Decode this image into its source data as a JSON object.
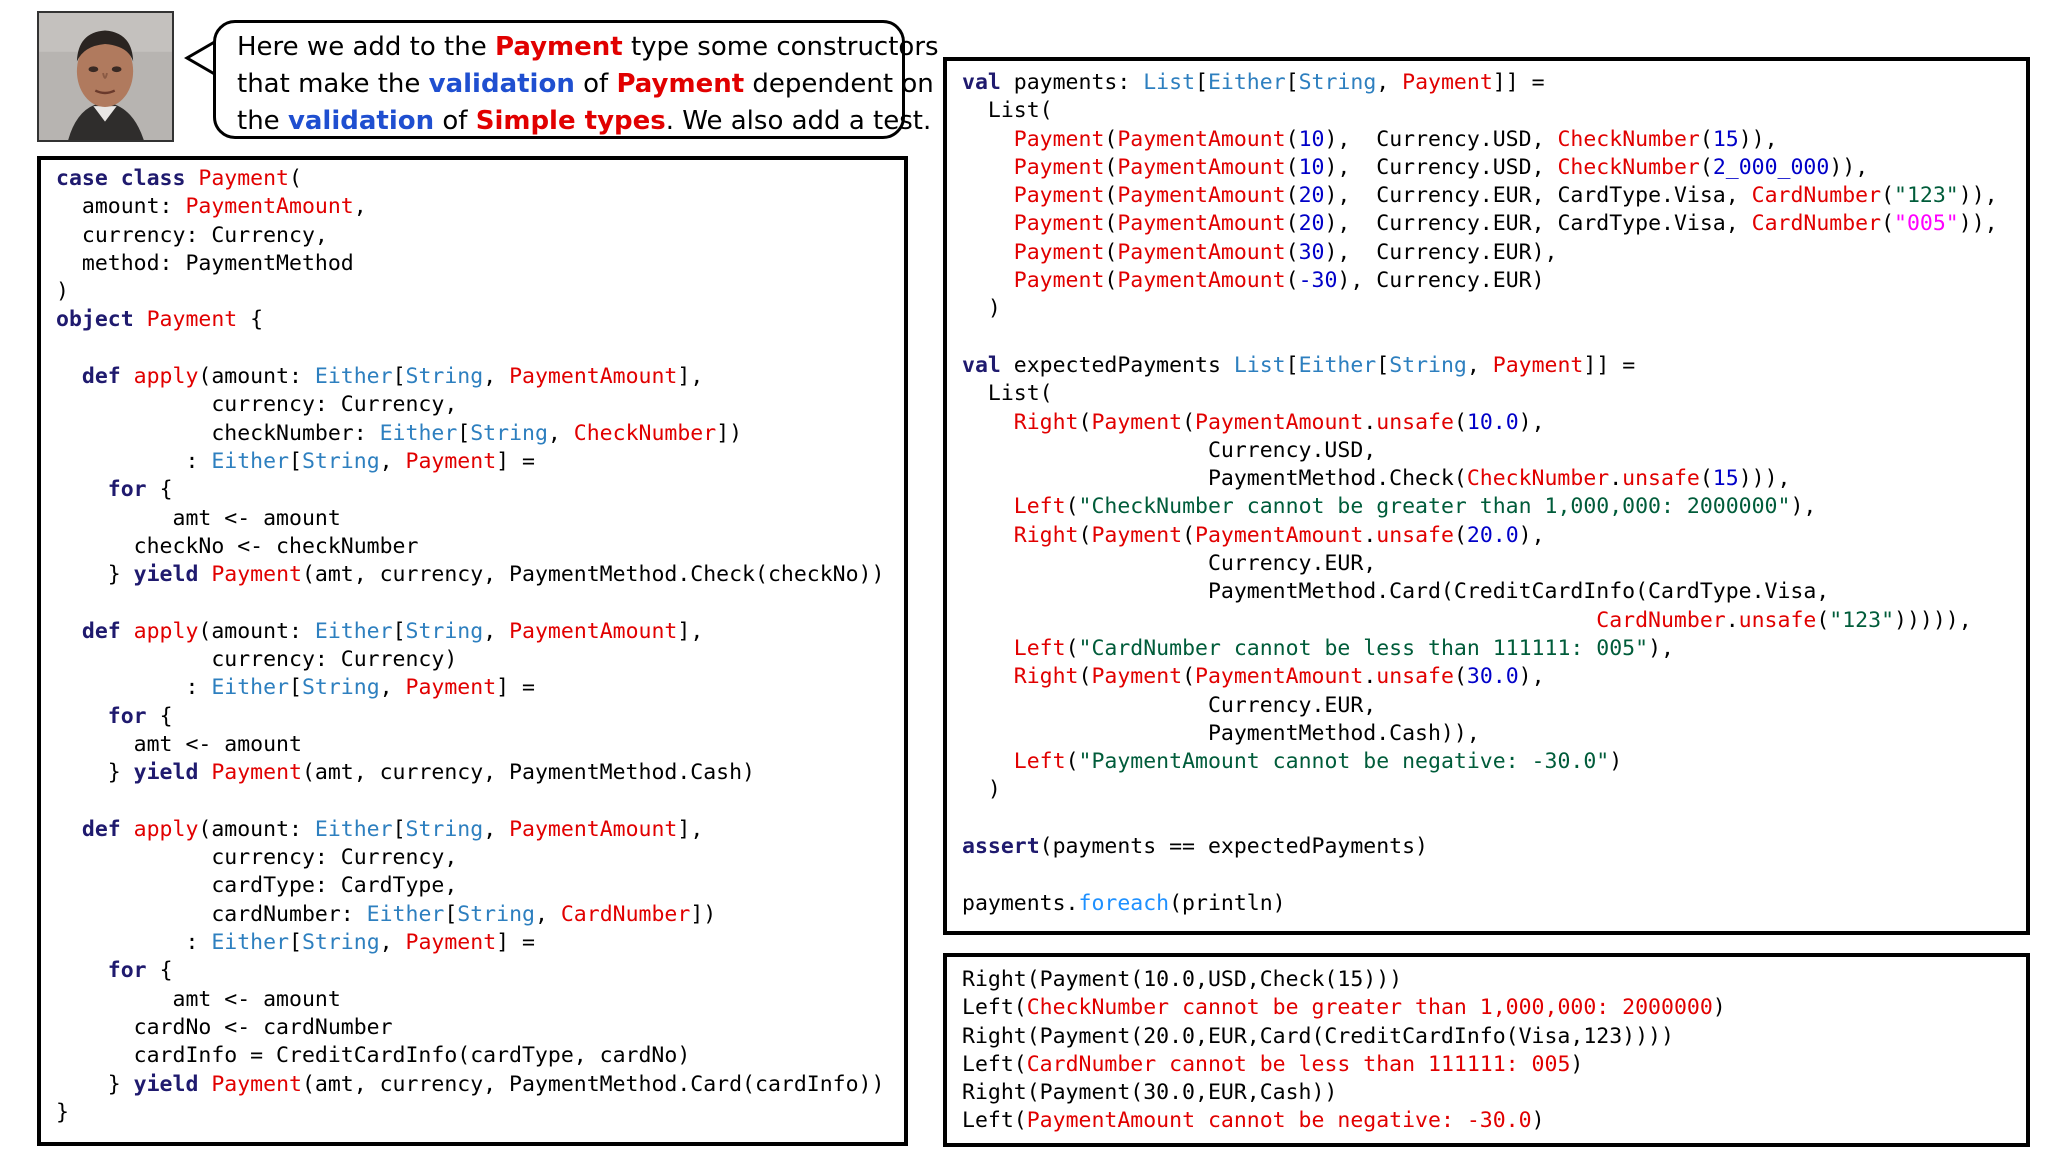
{
  "bubble": {
    "line1": [
      {
        "text": "Here we add to the ",
        "style": ""
      },
      {
        "text": "Payment",
        "style": "hi-red"
      },
      {
        "text": " type some constructors",
        "style": ""
      }
    ],
    "line2": [
      {
        "text": "that make the ",
        "style": ""
      },
      {
        "text": "validation",
        "style": "hi-blue"
      },
      {
        "text": " of ",
        "style": ""
      },
      {
        "text": "Payment",
        "style": "hi-red"
      },
      {
        "text": " dependent on",
        "style": ""
      }
    ],
    "line3": [
      {
        "text": "the ",
        "style": ""
      },
      {
        "text": "validation",
        "style": "hi-blue"
      },
      {
        "text": " of ",
        "style": ""
      },
      {
        "text": "Simple types",
        "style": "hi-red"
      },
      {
        "text": ". We also add a test.",
        "style": ""
      }
    ]
  },
  "left_code": [
    [
      [
        "kw",
        "case class "
      ],
      [
        "t",
        "Payment"
      ],
      [
        "p",
        "("
      ]
    ],
    [
      [
        "p",
        "  amount: "
      ],
      [
        "t",
        "PaymentAmount"
      ],
      [
        "p",
        ","
      ]
    ],
    [
      [
        "p",
        "  currency: Currency,"
      ]
    ],
    [
      [
        "p",
        "  method: PaymentMethod"
      ]
    ],
    [
      [
        "p",
        ")"
      ]
    ],
    [
      [
        "kw",
        "object "
      ],
      [
        "t",
        "Payment"
      ],
      [
        "p",
        " {"
      ]
    ],
    [
      [
        "p",
        ""
      ]
    ],
    [
      [
        "p",
        "  "
      ],
      [
        "kw",
        "def "
      ],
      [
        "t",
        "apply"
      ],
      [
        "p",
        "(amount: "
      ],
      [
        "n",
        "Either"
      ],
      [
        "p",
        "["
      ],
      [
        "n",
        "String"
      ],
      [
        "p",
        ", "
      ],
      [
        "t",
        "PaymentAmount"
      ],
      [
        "p",
        "],"
      ]
    ],
    [
      [
        "p",
        "            currency: Currency,"
      ]
    ],
    [
      [
        "p",
        "            checkNumber: "
      ],
      [
        "n",
        "Either"
      ],
      [
        "p",
        "["
      ],
      [
        "n",
        "String"
      ],
      [
        "p",
        ", "
      ],
      [
        "t",
        "CheckNumber"
      ],
      [
        "p",
        "])"
      ]
    ],
    [
      [
        "p",
        "          : "
      ],
      [
        "n",
        "Either"
      ],
      [
        "p",
        "["
      ],
      [
        "n",
        "String"
      ],
      [
        "p",
        ", "
      ],
      [
        "t",
        "Payment"
      ],
      [
        "p",
        "] ="
      ]
    ],
    [
      [
        "p",
        "    "
      ],
      [
        "kw",
        "for"
      ],
      [
        "p",
        " {"
      ]
    ],
    [
      [
        "p",
        "         amt <- amount"
      ]
    ],
    [
      [
        "p",
        "      checkNo <- checkNumber"
      ]
    ],
    [
      [
        "p",
        "    } "
      ],
      [
        "kw",
        "yield "
      ],
      [
        "t",
        "Payment"
      ],
      [
        "p",
        "(amt, currency, PaymentMethod.Check(checkNo))"
      ]
    ],
    [
      [
        "p",
        ""
      ]
    ],
    [
      [
        "p",
        "  "
      ],
      [
        "kw",
        "def "
      ],
      [
        "t",
        "apply"
      ],
      [
        "p",
        "(amount: "
      ],
      [
        "n",
        "Either"
      ],
      [
        "p",
        "["
      ],
      [
        "n",
        "String"
      ],
      [
        "p",
        ", "
      ],
      [
        "t",
        "PaymentAmount"
      ],
      [
        "p",
        "],"
      ]
    ],
    [
      [
        "p",
        "            currency: Currency)"
      ]
    ],
    [
      [
        "p",
        "          : "
      ],
      [
        "n",
        "Either"
      ],
      [
        "p",
        "["
      ],
      [
        "n",
        "String"
      ],
      [
        "p",
        ", "
      ],
      [
        "t",
        "Payment"
      ],
      [
        "p",
        "] ="
      ]
    ],
    [
      [
        "p",
        "    "
      ],
      [
        "kw",
        "for"
      ],
      [
        "p",
        " {"
      ]
    ],
    [
      [
        "p",
        "      amt <- amount"
      ]
    ],
    [
      [
        "p",
        "    } "
      ],
      [
        "kw",
        "yield "
      ],
      [
        "t",
        "Payment"
      ],
      [
        "p",
        "(amt, currency, PaymentMethod.Cash)"
      ]
    ],
    [
      [
        "p",
        ""
      ]
    ],
    [
      [
        "p",
        "  "
      ],
      [
        "kw",
        "def "
      ],
      [
        "t",
        "apply"
      ],
      [
        "p",
        "(amount: "
      ],
      [
        "n",
        "Either"
      ],
      [
        "p",
        "["
      ],
      [
        "n",
        "String"
      ],
      [
        "p",
        ", "
      ],
      [
        "t",
        "PaymentAmount"
      ],
      [
        "p",
        "],"
      ]
    ],
    [
      [
        "p",
        "            currency: Currency,"
      ]
    ],
    [
      [
        "p",
        "            cardType: CardType,"
      ]
    ],
    [
      [
        "p",
        "            cardNumber: "
      ],
      [
        "n",
        "Either"
      ],
      [
        "p",
        "["
      ],
      [
        "n",
        "String"
      ],
      [
        "p",
        ", "
      ],
      [
        "t",
        "CardNumber"
      ],
      [
        "p",
        "])"
      ]
    ],
    [
      [
        "p",
        "          : "
      ],
      [
        "n",
        "Either"
      ],
      [
        "p",
        "["
      ],
      [
        "n",
        "String"
      ],
      [
        "p",
        ", "
      ],
      [
        "t",
        "Payment"
      ],
      [
        "p",
        "] ="
      ]
    ],
    [
      [
        "p",
        "    "
      ],
      [
        "kw",
        "for"
      ],
      [
        "p",
        " {"
      ]
    ],
    [
      [
        "p",
        "         amt <- amount"
      ]
    ],
    [
      [
        "p",
        "      cardNo <- cardNumber"
      ]
    ],
    [
      [
        "p",
        "      cardInfo = CreditCardInfo(cardType, cardNo)"
      ]
    ],
    [
      [
        "p",
        "    } "
      ],
      [
        "kw",
        "yield "
      ],
      [
        "t",
        "Payment"
      ],
      [
        "p",
        "(amt, currency, PaymentMethod.Card(cardInfo))"
      ]
    ],
    [
      [
        "p",
        "}"
      ]
    ]
  ],
  "right_code": [
    [
      [
        "kw",
        "val "
      ],
      [
        "p",
        "payments: "
      ],
      [
        "n",
        "List"
      ],
      [
        "p",
        "["
      ],
      [
        "n",
        "Either"
      ],
      [
        "p",
        "["
      ],
      [
        "n",
        "String"
      ],
      [
        "p",
        ", "
      ],
      [
        "t",
        "Payment"
      ],
      [
        "p",
        "]] ="
      ]
    ],
    [
      [
        "p",
        "  List("
      ]
    ],
    [
      [
        "p",
        "    "
      ],
      [
        "t",
        "Payment"
      ],
      [
        "p",
        "("
      ],
      [
        "t",
        "PaymentAmount"
      ],
      [
        "p",
        "("
      ],
      [
        "num",
        "10"
      ],
      [
        "p",
        "),  Currency.USD, "
      ],
      [
        "t",
        "CheckNumber"
      ],
      [
        "p",
        "("
      ],
      [
        "num",
        "15"
      ],
      [
        "p",
        ")),"
      ]
    ],
    [
      [
        "p",
        "    "
      ],
      [
        "t",
        "Payment"
      ],
      [
        "p",
        "("
      ],
      [
        "t",
        "PaymentAmount"
      ],
      [
        "p",
        "("
      ],
      [
        "num",
        "10"
      ],
      [
        "p",
        "),  Currency.USD, "
      ],
      [
        "t",
        "CheckNumber"
      ],
      [
        "p",
        "("
      ],
      [
        "num",
        "2_000_000"
      ],
      [
        "p",
        ")),"
      ]
    ],
    [
      [
        "p",
        "    "
      ],
      [
        "t",
        "Payment"
      ],
      [
        "p",
        "("
      ],
      [
        "t",
        "PaymentAmount"
      ],
      [
        "p",
        "("
      ],
      [
        "num",
        "20"
      ],
      [
        "p",
        "),  Currency.EUR, CardType.Visa, "
      ],
      [
        "t",
        "CardNumber"
      ],
      [
        "p",
        "("
      ],
      [
        "s",
        "\"123\""
      ],
      [
        "p",
        ")),"
      ]
    ],
    [
      [
        "p",
        "    "
      ],
      [
        "t",
        "Payment"
      ],
      [
        "p",
        "("
      ],
      [
        "t",
        "PaymentAmount"
      ],
      [
        "p",
        "("
      ],
      [
        "num",
        "20"
      ],
      [
        "p",
        "),  Currency.EUR, CardType.Visa, "
      ],
      [
        "t",
        "CardNumber"
      ],
      [
        "p",
        "("
      ],
      [
        "num5",
        "\"005\""
      ],
      [
        "p",
        ")),"
      ]
    ],
    [
      [
        "p",
        "    "
      ],
      [
        "t",
        "Payment"
      ],
      [
        "p",
        "("
      ],
      [
        "t",
        "PaymentAmount"
      ],
      [
        "p",
        "("
      ],
      [
        "num",
        "30"
      ],
      [
        "p",
        "),  Currency.EUR),"
      ]
    ],
    [
      [
        "p",
        "    "
      ],
      [
        "t",
        "Payment"
      ],
      [
        "p",
        "("
      ],
      [
        "t",
        "PaymentAmount"
      ],
      [
        "p",
        "("
      ],
      [
        "num",
        "-30"
      ],
      [
        "p",
        "), Currency.EUR)"
      ]
    ],
    [
      [
        "p",
        "  )"
      ]
    ],
    [
      [
        "p",
        ""
      ]
    ],
    [
      [
        "kw",
        "val "
      ],
      [
        "p",
        "expectedPayments "
      ],
      [
        "n",
        "List"
      ],
      [
        "p",
        "["
      ],
      [
        "n",
        "Either"
      ],
      [
        "p",
        "["
      ],
      [
        "n",
        "String"
      ],
      [
        "p",
        ", "
      ],
      [
        "t",
        "Payment"
      ],
      [
        "p",
        "]] ="
      ]
    ],
    [
      [
        "p",
        "  List("
      ]
    ],
    [
      [
        "p",
        "    "
      ],
      [
        "t",
        "Right"
      ],
      [
        "p",
        "("
      ],
      [
        "t",
        "Payment"
      ],
      [
        "p",
        "("
      ],
      [
        "t",
        "PaymentAmount"
      ],
      [
        "p",
        "."
      ],
      [
        "t",
        "unsafe"
      ],
      [
        "p",
        "("
      ],
      [
        "num",
        "10.0"
      ],
      [
        "p",
        "),"
      ]
    ],
    [
      [
        "p",
        "                   Currency.USD,"
      ]
    ],
    [
      [
        "p",
        "                   PaymentMethod.Check("
      ],
      [
        "t",
        "CheckNumber"
      ],
      [
        "p",
        "."
      ],
      [
        "t",
        "unsafe"
      ],
      [
        "p",
        "("
      ],
      [
        "num",
        "15"
      ],
      [
        "p",
        "))),"
      ]
    ],
    [
      [
        "p",
        "    "
      ],
      [
        "t",
        "Left"
      ],
      [
        "p",
        "("
      ],
      [
        "s",
        "\"CheckNumber cannot be greater than 1,000,000: 2000000\""
      ],
      [
        "p",
        "),"
      ]
    ],
    [
      [
        "p",
        "    "
      ],
      [
        "t",
        "Right"
      ],
      [
        "p",
        "("
      ],
      [
        "t",
        "Payment"
      ],
      [
        "p",
        "("
      ],
      [
        "t",
        "PaymentAmount"
      ],
      [
        "p",
        "."
      ],
      [
        "t",
        "unsafe"
      ],
      [
        "p",
        "("
      ],
      [
        "num",
        "20.0"
      ],
      [
        "p",
        "),"
      ]
    ],
    [
      [
        "p",
        "                   Currency.EUR,"
      ]
    ],
    [
      [
        "p",
        "                   PaymentMethod.Card(CreditCardInfo(CardType.Visa,"
      ]
    ],
    [
      [
        "p",
        "                                                 "
      ],
      [
        "t",
        "CardNumber"
      ],
      [
        "p",
        "."
      ],
      [
        "t",
        "unsafe"
      ],
      [
        "p",
        "("
      ],
      [
        "s",
        "\"123\""
      ],
      [
        "p",
        "))))),"
      ]
    ],
    [
      [
        "p",
        "    "
      ],
      [
        "t",
        "Left"
      ],
      [
        "p",
        "("
      ],
      [
        "s",
        "\"CardNumber cannot be less than 111111: 005\""
      ],
      [
        "p",
        "),"
      ]
    ],
    [
      [
        "p",
        "    "
      ],
      [
        "t",
        "Right"
      ],
      [
        "p",
        "("
      ],
      [
        "t",
        "Payment"
      ],
      [
        "p",
        "("
      ],
      [
        "t",
        "PaymentAmount"
      ],
      [
        "p",
        "."
      ],
      [
        "t",
        "unsafe"
      ],
      [
        "p",
        "("
      ],
      [
        "num",
        "30.0"
      ],
      [
        "p",
        "),"
      ]
    ],
    [
      [
        "p",
        "                   Currency.EUR,"
      ]
    ],
    [
      [
        "p",
        "                   PaymentMethod.Cash)),"
      ]
    ],
    [
      [
        "p",
        "    "
      ],
      [
        "t",
        "Left"
      ],
      [
        "p",
        "("
      ],
      [
        "s",
        "\"PaymentAmount cannot be negative: -30.0\""
      ],
      [
        "p",
        ")"
      ]
    ],
    [
      [
        "p",
        "  )"
      ]
    ],
    [
      [
        "p",
        ""
      ]
    ],
    [
      [
        "kw",
        "assert"
      ],
      [
        "p",
        "(payments == expectedPayments)"
      ]
    ],
    [
      [
        "p",
        ""
      ]
    ],
    [
      [
        "p",
        "payments."
      ],
      [
        "fe",
        "foreach"
      ],
      [
        "p",
        "(println)"
      ]
    ]
  ],
  "output": [
    [
      [
        "p",
        "Right(Payment(10.0,USD,Check(15)))"
      ]
    ],
    [
      [
        "p",
        "Left("
      ],
      [
        "out-red",
        "CheckNumber cannot be greater than 1,000,000: 2000000"
      ],
      [
        "p",
        ")"
      ]
    ],
    [
      [
        "p",
        "Right(Payment(20.0,EUR,Card(CreditCardInfo(Visa,123))))"
      ]
    ],
    [
      [
        "p",
        "Left("
      ],
      [
        "out-red",
        "CardNumber cannot be less than 111111: 005"
      ],
      [
        "p",
        ")"
      ]
    ],
    [
      [
        "p",
        "Right(Payment(30.0,EUR,Cash))"
      ]
    ],
    [
      [
        "p",
        "Left("
      ],
      [
        "out-red",
        "PaymentAmount cannot be negative: -30.0"
      ],
      [
        "p",
        ")"
      ]
    ]
  ]
}
